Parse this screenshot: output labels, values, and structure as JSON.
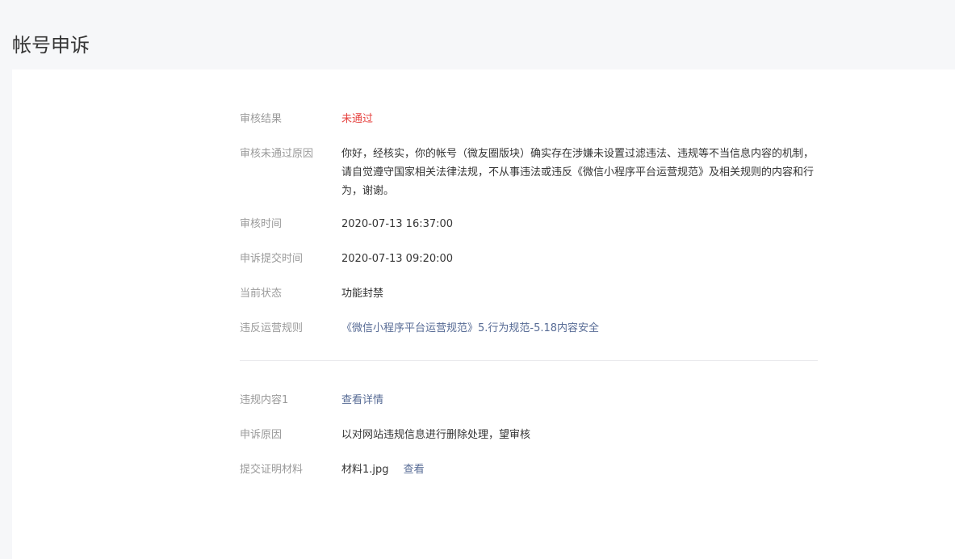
{
  "page": {
    "title": "帐号申诉"
  },
  "review": {
    "result_label": "审核结果",
    "result_value": "未通过",
    "reason_label": "审核未通过原因",
    "reason_value": "你好，经核实，你的帐号（微友圈版块）确实存在涉嫌未设置过滤违法、违规等不当信息内容的机制，请自觉遵守国家相关法律法规，不从事违法或违反《微信小程序平台运营规范》及相关规则的内容和行为，谢谢。",
    "time_label": "审核时间",
    "time_value": "2020-07-13 16:37:00",
    "submit_time_label": "申诉提交时间",
    "submit_time_value": "2020-07-13 09:20:00",
    "status_label": "当前状态",
    "status_value": "功能封禁",
    "rule_label": "违反运营规则",
    "rule_value": "《微信小程序平台运营规范》5.行为规范-5.18内容安全"
  },
  "appeal": {
    "content_label": "违规内容1",
    "content_link": "查看详情",
    "reason_label": "申诉原因",
    "reason_value": "以对网站违规信息进行删除处理，望审核",
    "material_label": "提交证明材料",
    "material_file": "材料1.jpg",
    "material_view": "查看"
  },
  "colors": {
    "fail_red": "#e64340",
    "link_blue": "#576b95",
    "label_gray": "#9a9a9a",
    "text_dark": "#353535"
  }
}
